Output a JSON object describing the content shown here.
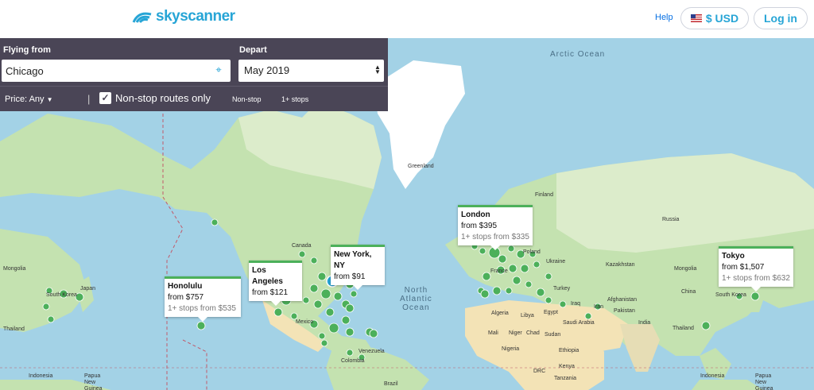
{
  "header": {
    "logo_text": "skyscanner",
    "help": "Help",
    "currency": "$ USD",
    "login": "Log in"
  },
  "search": {
    "from_label": "Flying from",
    "from_value": "Chicago",
    "depart_label": "Depart",
    "depart_value": "May 2019",
    "price_filter": "Price: Any",
    "nonstop_toggle": "Non-stop routes only",
    "nonstop_tab": "Non-stop",
    "stops_tab": "1+ stops"
  },
  "popups": [
    {
      "city": "Honolulu",
      "price": "from $757",
      "stops": "1+ stops from $535"
    },
    {
      "city": "Los Angeles",
      "price": "from $121",
      "stops": ""
    },
    {
      "city": "New York, NY",
      "price": "from $91",
      "stops": ""
    },
    {
      "city": "London",
      "price": "from $395",
      "stops": "1+ stops from $335"
    },
    {
      "city": "Tokyo",
      "price": "from $1,507",
      "stops": "1+ stops from $632"
    }
  ],
  "map": {
    "oceans": [
      "Arctic Ocean",
      "North\nAtlantic\nOcean"
    ],
    "places": [
      "Greenland",
      "Finland",
      "Russia",
      "Canada",
      "Poland",
      "Ukraine",
      "Kazakhstan",
      "France",
      "Turkey",
      "Mongolia",
      "China",
      "Japan",
      "South Korea",
      "Thailand",
      "Mexico",
      "Venezuela",
      "Colombia",
      "Brazil",
      "Algeria",
      "Libya",
      "Egypt",
      "Iraq",
      "Iran",
      "Afghanistan",
      "Pakistan",
      "India",
      "Saudi Arabia",
      "Mali",
      "Niger",
      "Chad",
      "Sudan",
      "Nigeria",
      "Ethiopia",
      "Kenya",
      "DRC",
      "Tanzania",
      "Indonesia",
      "Papua New Guinea",
      "Mongolia",
      "South Korea",
      "Thailand",
      "Japan",
      "Indonesia",
      "Papua New Guinea"
    ]
  },
  "colors": {
    "brand": "#27a5d6",
    "panel": "#4a4556",
    "pin": "#4cb05a",
    "ocean": "#a3d2e6"
  }
}
